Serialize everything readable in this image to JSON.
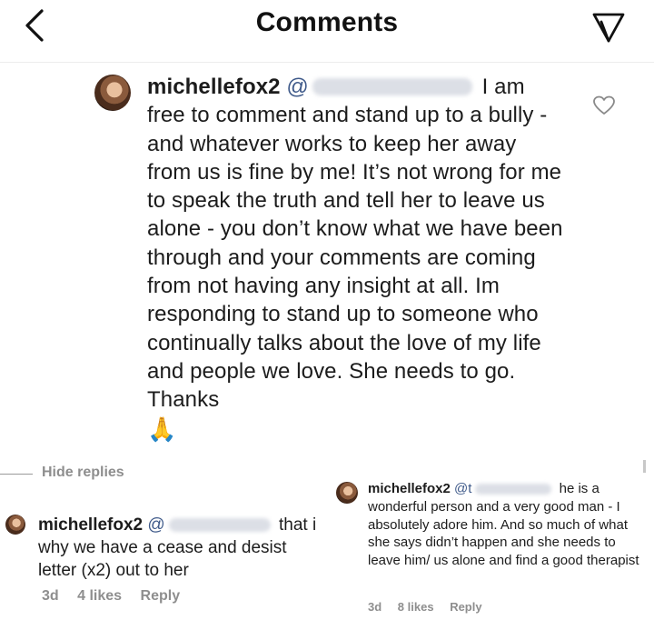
{
  "header": {
    "title": "Comments",
    "back_icon": "chevron-left-icon",
    "send_icon": "paper-plane-icon"
  },
  "main_comment": {
    "username": "michellefox2",
    "mention_prefix": "@",
    "text": "I am free to comment and stand up to a bully - and whatever works to keep her away from us is fine by me! It’s not wrong for me to speak the truth and tell her to leave us alone - you don’t know what we have been through and your comments are coming from not having any insight at all. Im responding to stand up to someone who continually talks about the love of my life and people we love. She needs to go. Thanks",
    "emoji": "🙏",
    "like_icon": "heart-outline-icon"
  },
  "hide_replies_label": "Hide replies",
  "reply_left": {
    "username": "michellefox2",
    "mention_prefix": "@",
    "text_start": "that i",
    "text": "why we have a cease and desist letter (x2) out to her",
    "time": "3d",
    "likes": "4 likes",
    "reply_label": "Reply"
  },
  "reply_right": {
    "username": "michellefox2",
    "mention_prefix": "@t",
    "text": "he is a wonderful person and a very good man - I absolutely adore him. And so much of what she says didn’t happen and she needs to leave him/ us alone and find a good therapist",
    "time": "3d",
    "likes": "8 likes",
    "reply_label": "Reply"
  },
  "colors": {
    "mention": "#3f5a8a",
    "meta_gray": "#8e8e8e"
  }
}
